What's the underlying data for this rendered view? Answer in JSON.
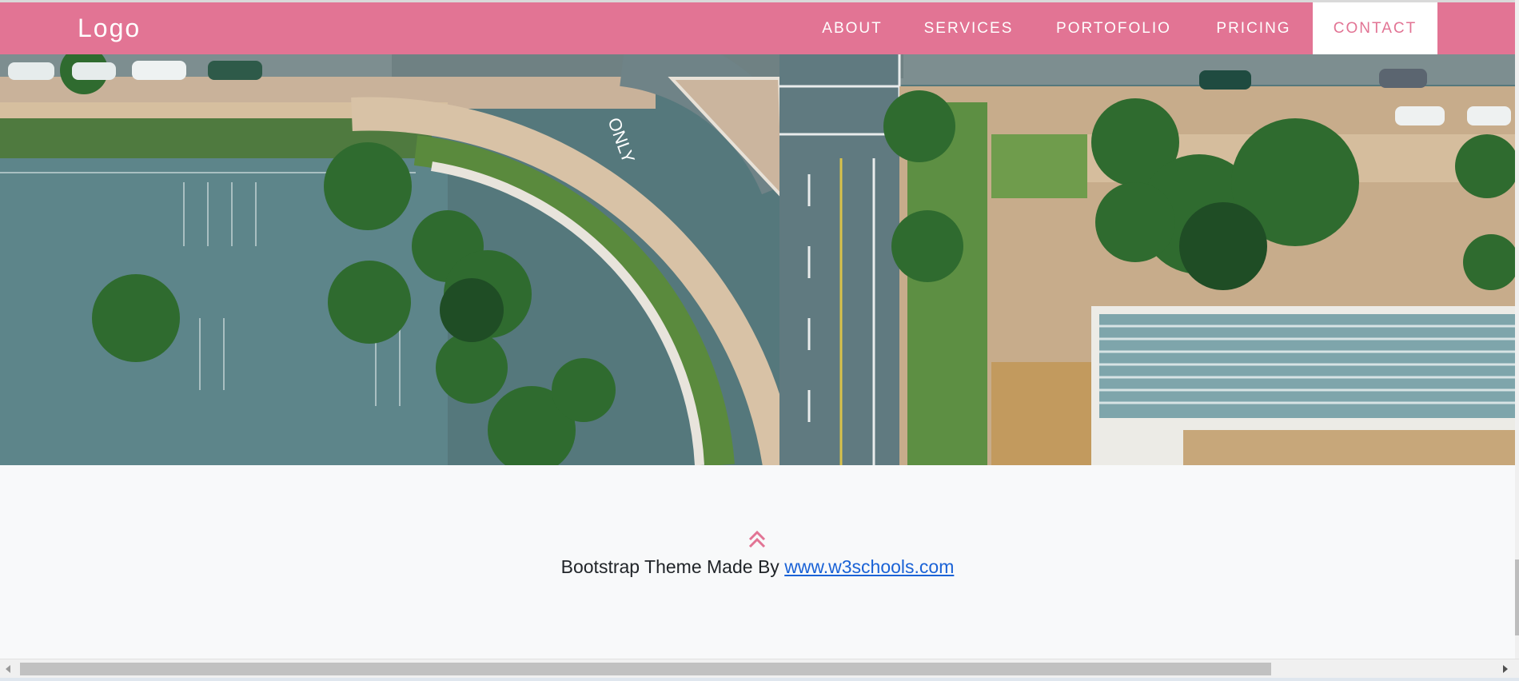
{
  "navbar": {
    "logo": "Logo",
    "items": [
      {
        "label": "ABOUT"
      },
      {
        "label": "SERVICES"
      },
      {
        "label": "PORTOFOLIO"
      },
      {
        "label": "PRICING"
      },
      {
        "label": "CONTACT",
        "active": true
      }
    ]
  },
  "hero": {
    "road_marking": "ONLY"
  },
  "footer": {
    "up_icon": "double-chevron-up-icon",
    "credit_prefix": "Bootstrap Theme Made By ",
    "credit_link": "www.w3schools.com"
  },
  "colors": {
    "accent": "#e27494",
    "footer_bg": "#f8f9fa",
    "link": "#1a62d6"
  }
}
